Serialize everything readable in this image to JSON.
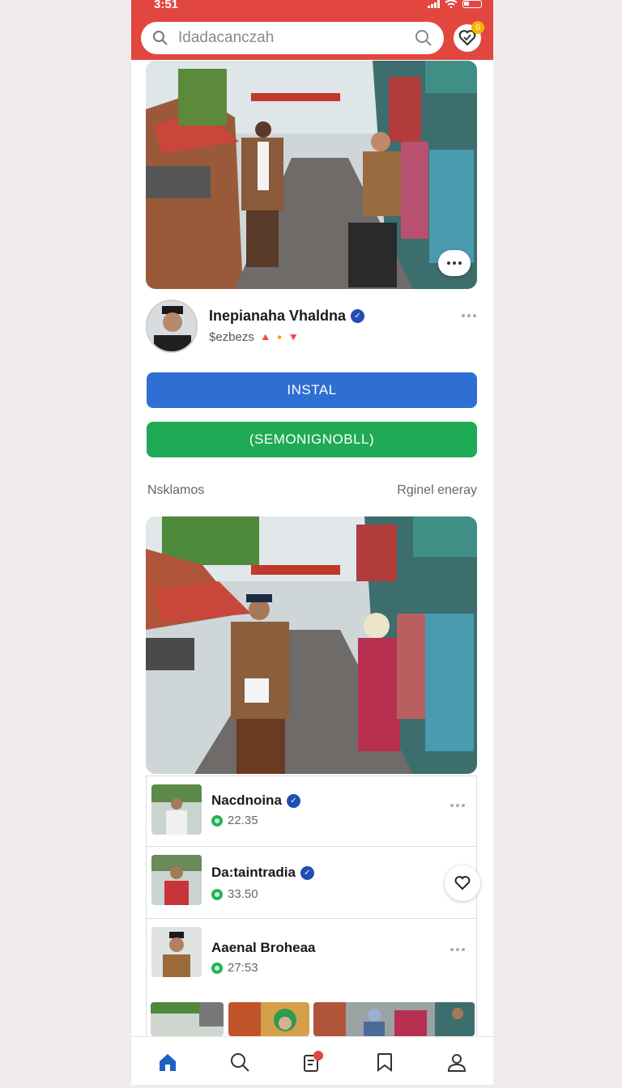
{
  "status": {
    "time": "3:51"
  },
  "search": {
    "placeholder": "Idadacanczah",
    "badge_count": "0"
  },
  "hero": {
    "menu_icon": "more-dots-icon"
  },
  "profile": {
    "name": "Inepianaha Vhaldna",
    "sub": "$ezbezs",
    "emoji": "🔺🔸🔻"
  },
  "buttons": {
    "install": "INSTAL",
    "secondary": "(SEMONIGNOBLL)"
  },
  "section": {
    "left": "Nsklamos",
    "right": "Rginel eneray"
  },
  "list": [
    {
      "name": "Nacdnoina",
      "meta": "22.35"
    },
    {
      "name": "Da:taintradia",
      "meta": "33.50"
    },
    {
      "name": "Aaenal Broheaa",
      "meta": "27:53"
    }
  ],
  "nav": [
    "home-icon",
    "search-icon",
    "notes-icon",
    "bookmark-icon",
    "profile-icon"
  ],
  "colors": {
    "brand": "#e2473f",
    "blue": "#2f6fd4",
    "green": "#1faa55",
    "verified": "#1f4fb3"
  }
}
